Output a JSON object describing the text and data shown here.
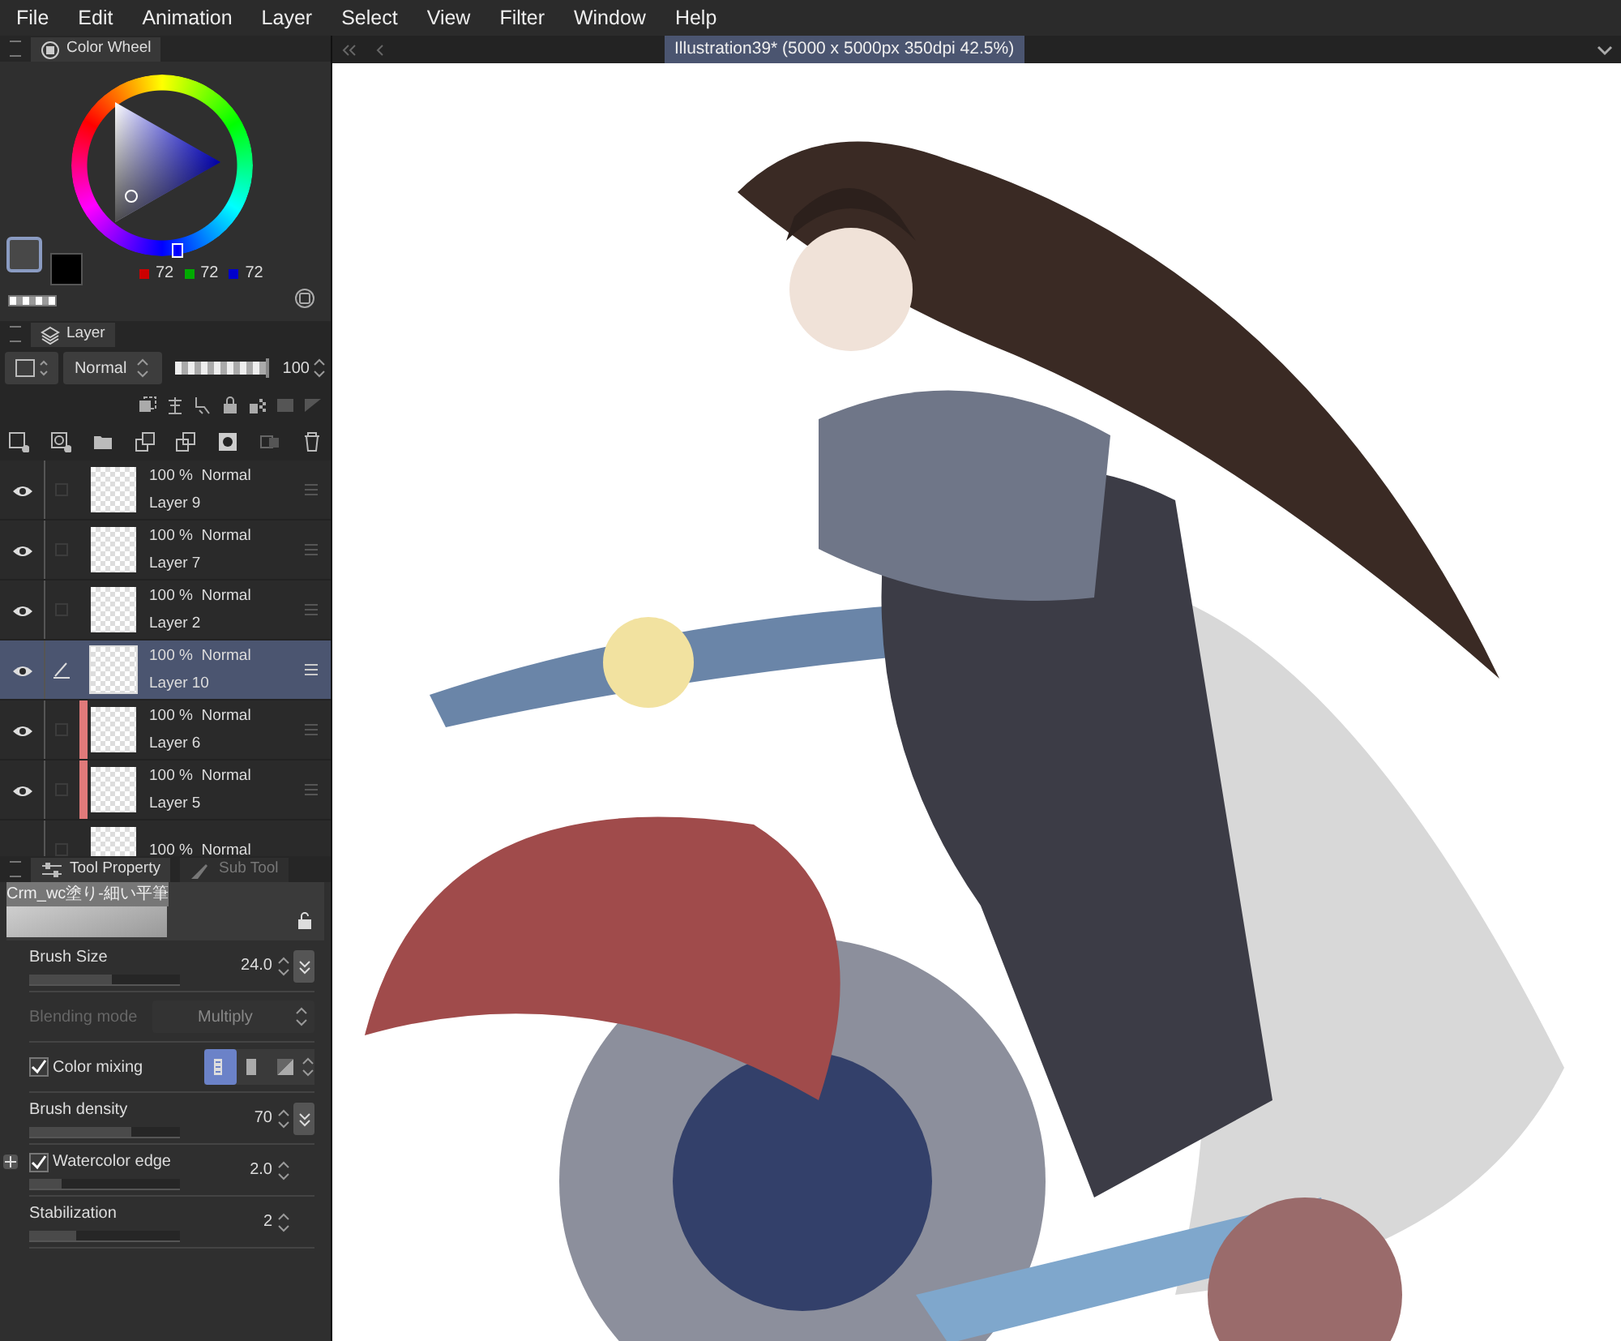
{
  "menu": [
    "File",
    "Edit",
    "Animation",
    "Layer",
    "Select",
    "View",
    "Filter",
    "Window",
    "Help"
  ],
  "document_tabs": [
    {
      "title": "Illustration39* (5000 x 5000px 350dpi 42.5%)",
      "selected": true
    }
  ],
  "color_wheel": {
    "title": "Color Wheel",
    "red": "72",
    "green": "72",
    "blue": "72"
  },
  "layer_panel": {
    "title": "Layer",
    "blend_mode": "Normal",
    "opacity": "100",
    "opacity_slider": {
      "level": 1
    },
    "layers": [
      {
        "opacity": "100 %",
        "mode": "Normal",
        "name": "Layer 9",
        "visible": true,
        "selected": false,
        "editing": false
      },
      {
        "opacity": "100 %",
        "mode": "Normal",
        "name": "Layer 7",
        "visible": true,
        "selected": false,
        "editing": false
      },
      {
        "opacity": "100 %",
        "mode": "Normal",
        "name": "Layer 2",
        "visible": true,
        "selected": false,
        "editing": false
      },
      {
        "opacity": "100 %",
        "mode": "Normal",
        "name": "Layer 10",
        "visible": true,
        "selected": true,
        "editing": true
      },
      {
        "opacity": "100 %",
        "mode": "Normal",
        "name": "Layer 6",
        "visible": true,
        "selected": false,
        "editing": false,
        "color": "#e07a7a"
      },
      {
        "opacity": "100 %",
        "mode": "Normal",
        "name": "Layer 5",
        "visible": true,
        "selected": false,
        "editing": false,
        "color": "#e07a7a"
      },
      {
        "opacity": "100 %",
        "mode": "Normal",
        "selected": false
      }
    ]
  },
  "tool_property": {
    "tabs": [
      {
        "label": "Tool Property",
        "selected": true
      },
      {
        "label": "Sub Tool",
        "selected": false
      }
    ],
    "brush_name": "Crm_wc塗り-細い平筆",
    "properties": [
      {
        "kind": "slider",
        "label": "Brush Size",
        "value": "24.0",
        "level": 0.55
      },
      {
        "kind": "select",
        "label": "Blending mode",
        "value": "Multiply",
        "disabled": true
      },
      {
        "kind": "toggle",
        "label": "Color mixing",
        "checked": true
      },
      {
        "kind": "slider",
        "label": "Brush density",
        "value": "70",
        "level": 0.68
      },
      {
        "kind": "slider",
        "label": "Watercolor edge",
        "value": "2.0",
        "level": 0.22,
        "checked": true
      },
      {
        "kind": "slider",
        "label": "Stabilization",
        "value": "2",
        "level": 0.31
      }
    ]
  }
}
